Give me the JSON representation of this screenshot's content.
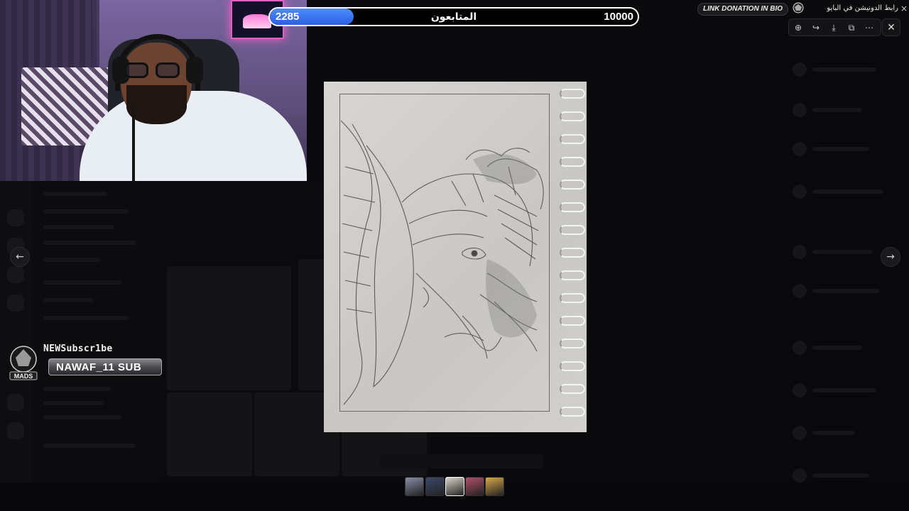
{
  "followers": {
    "current": "2285",
    "label": "المتابعون",
    "goal": "10000",
    "progress_fraction": 0.2285,
    "fill_color": "#3a73f0"
  },
  "donation": {
    "english": "LINK DONATION IN BIO",
    "arabic": "رابط الدونيشن في البايو",
    "logo_text": "MADS",
    "close_icon": "×"
  },
  "viewer": {
    "toolbar_icons": [
      "zoom-in-icon",
      "share-icon",
      "download-icon",
      "open-external-icon",
      "more-icon"
    ],
    "toolbar_glyphs": [
      "⊕",
      "↪",
      "⤓",
      "⧉",
      "⋯"
    ],
    "close_glyph": "✕",
    "prev_glyph": "←",
    "next_glyph": "→"
  },
  "new_subscriber": {
    "title": "NEWSubscr1be",
    "name": "NAWAF_11 SUB",
    "logo_text": "MADS"
  },
  "thumbnails": {
    "count": 5,
    "colors": [
      "#8a8fa8",
      "#3b4a6a",
      "#d9d2c8",
      "#b0506a",
      "#d9a84a"
    ]
  }
}
